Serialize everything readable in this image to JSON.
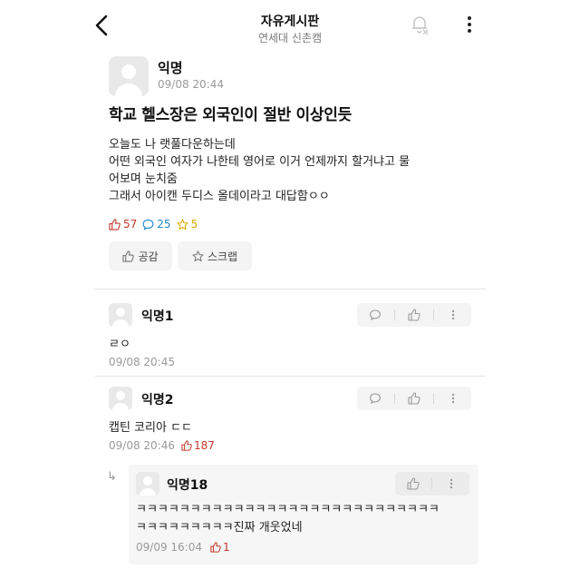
{
  "header": {
    "title": "자유게시판",
    "subtitle": "연세대 신촌캠",
    "back_icon": "chevron-left-icon",
    "notify_icon": "bell-off-icon",
    "more_icon": "more-vertical-icon"
  },
  "post": {
    "author": "익명",
    "time": "09/08 20:44",
    "title": "학교 헬스장은 외국인이 절반 이상인듯",
    "body_lines": [
      "오늘도 나 랫풀다운하는데",
      "어떤 외국인 여자가 나한테 영어로 이거 언제까지 할거냐고 물",
      "어보며 눈치줌",
      "그래서 아이캔 두디스 올데이라고 대답함ㅇㅇ"
    ],
    "likes": "57",
    "comments": "25",
    "scraps": "5",
    "like_button": "공감",
    "scrap_button": "스크랩"
  },
  "comments": [
    {
      "author": "익명1",
      "text": "ㄹㅇ",
      "time": "09/08 20:45",
      "likes": ""
    },
    {
      "author": "익명2",
      "text": "캡틴 코리아 ㄷㄷ",
      "time": "09/08 20:46",
      "likes": "187"
    }
  ],
  "reply": {
    "author": "익명18",
    "lines": [
      "ㅋㅋㅋㅋㅋㅋㅋㅋㅋㅋㅋㅋㅋㅋㅋㅋㅋㅋㅋㅋㅋㅋㅋㅋㅋㅋㅋㅋ",
      "ㅋㅋㅋㅋㅋㅋㅋㅋㅋ진짜 개웃었네"
    ],
    "time": "09/09 16:04",
    "likes": "1"
  },
  "colors": {
    "like": "#c0392b",
    "comment": "#1e88c8",
    "scrap": "#e0a800",
    "muted": "#9a9a9a"
  }
}
